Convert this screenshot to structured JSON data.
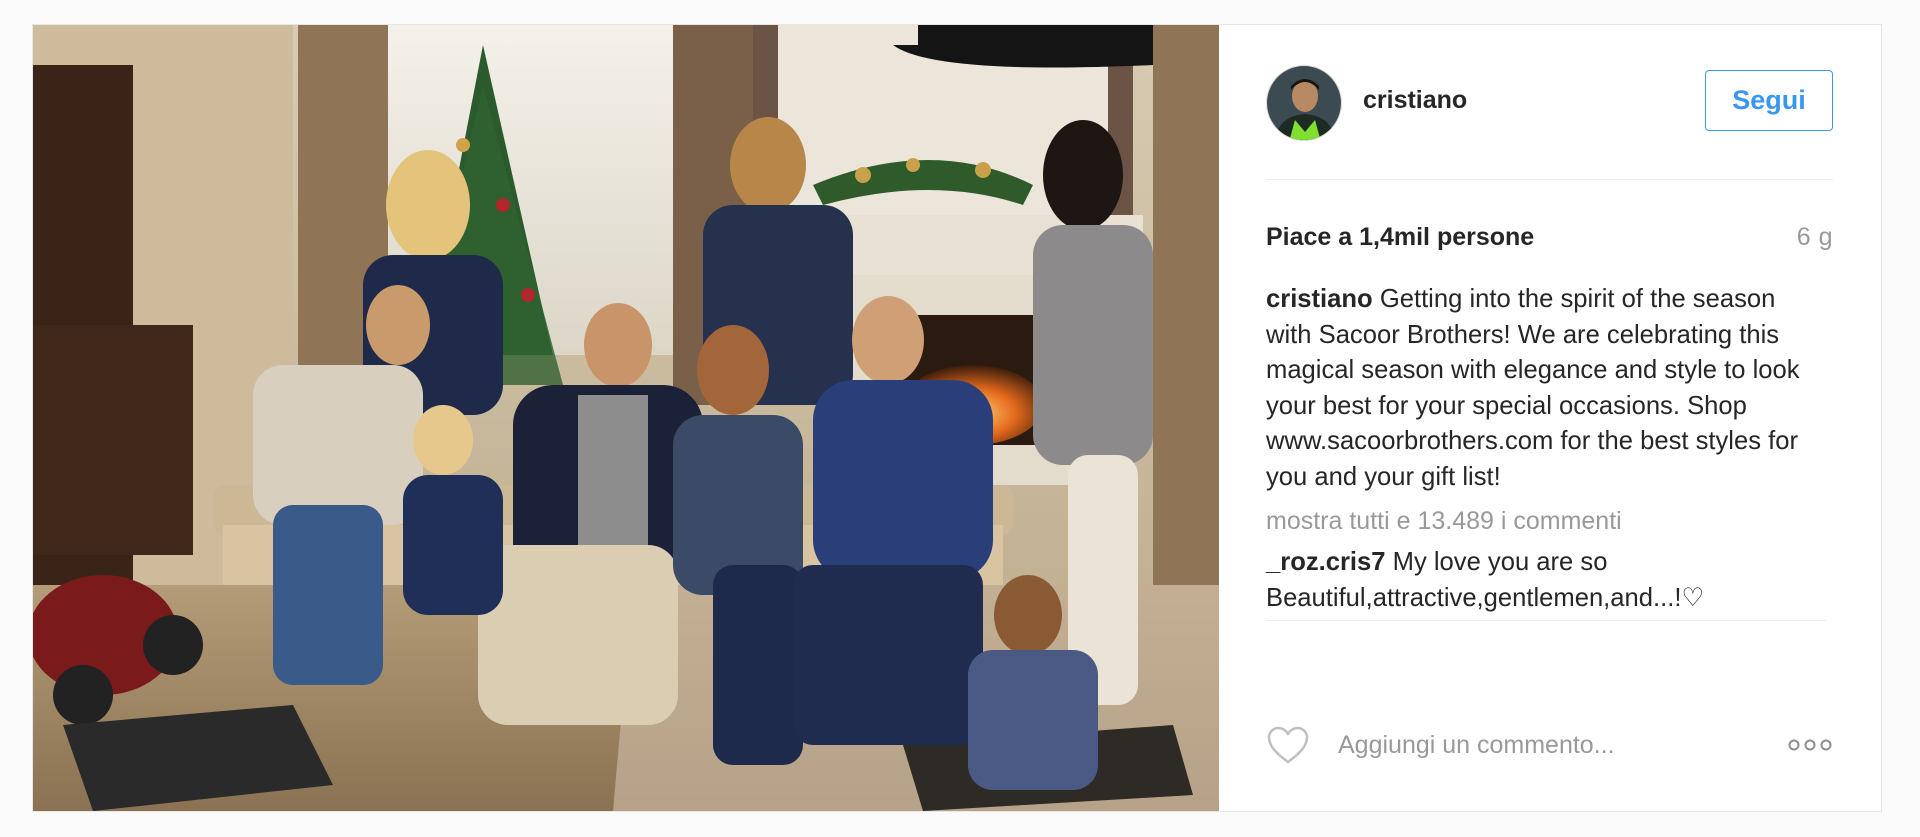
{
  "post": {
    "image_alt": "Group photo of family in festive living room with Christmas tree and fireplace",
    "user": {
      "username": "cristiano",
      "follow_label": "Segui"
    },
    "likes_text": "Piace a 1,4mil persone",
    "time_ago": "6 g",
    "caption": {
      "author": "cristiano",
      "text": "Getting into the spirit of the season with Sacoor Brothers! We are celebrating this magical season with elegance and style to look your best for your special occasions. Shop www.sacoorbrothers.com for the best styles for you and your gift list!"
    },
    "view_all_comments": "mostra tutti e 13.489 i commenti",
    "comments": [
      {
        "author": "_roz.cris7",
        "text": "My love you are so Beautiful,attractive,gentlemen,and...!♡"
      }
    ],
    "comment_placeholder": "Aggiungi un commento...",
    "colors": {
      "accent": "#3897f0",
      "muted_text": "#999999",
      "text": "#262626"
    },
    "icons": {
      "like": "heart-outline-icon",
      "options": "ellipsis-icon"
    }
  }
}
